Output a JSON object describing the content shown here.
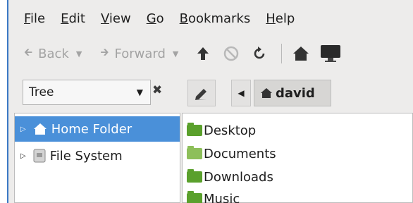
{
  "colors": {
    "accent": "#3b78c4",
    "selection": "#4a90d9",
    "folder_green": "#5aa02c",
    "folder_green_light": "#8dbf5a",
    "disabled_text": "#a3a3a3"
  },
  "menubar": {
    "items": [
      {
        "mnemonic": "F",
        "rest": "ile"
      },
      {
        "mnemonic": "E",
        "rest": "dit"
      },
      {
        "mnemonic": "V",
        "rest": "iew"
      },
      {
        "mnemonic": "G",
        "rest": "o"
      },
      {
        "mnemonic": "B",
        "rest": "ookmarks"
      },
      {
        "mnemonic": "H",
        "rest": "elp"
      }
    ]
  },
  "navbar": {
    "back_label": "Back",
    "forward_label": "Forward",
    "icons": [
      "back-arrow-icon",
      "forward-arrow-icon",
      "up-arrow-icon",
      "stop-icon",
      "reload-icon",
      "home-icon",
      "computer-icon"
    ]
  },
  "location": {
    "side_pane_mode": "Tree",
    "breadcrumb_current": "david"
  },
  "sidepane": {
    "items": [
      {
        "label": "Home Folder",
        "icon": "home-icon",
        "selected": true
      },
      {
        "label": "File System",
        "icon": "drive-icon",
        "selected": false
      }
    ]
  },
  "files": [
    {
      "name": "Desktop",
      "icon": "desktop-folder-icon"
    },
    {
      "name": "Documents",
      "icon": "documents-folder-icon"
    },
    {
      "name": "Downloads",
      "icon": "downloads-folder-icon"
    },
    {
      "name": "Music",
      "icon": "music-folder-icon"
    }
  ]
}
